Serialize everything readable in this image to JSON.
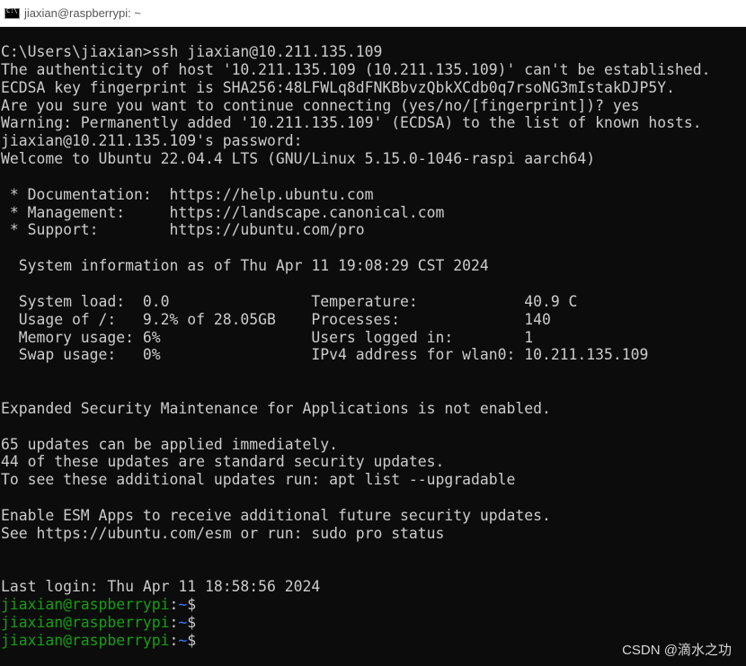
{
  "window": {
    "title": "jiaxian@raspberrypi: ~"
  },
  "terminal": {
    "colors": {
      "background": "#0c0c0c",
      "text": "#cccccc",
      "prompt_user": "#13a10e",
      "prompt_path": "#3b78ff"
    },
    "lines": [
      "C:\\Users\\jiaxian>ssh jiaxian@10.211.135.109",
      "The authenticity of host '10.211.135.109 (10.211.135.109)' can't be established.",
      "ECDSA key fingerprint is SHA256:48LFWLq8dFNKBbvzQbkXCdb0q7rsoNG3mIstakDJP5Y.",
      "Are you sure you want to continue connecting (yes/no/[fingerprint])? yes",
      "Warning: Permanently added '10.211.135.109' (ECDSA) to the list of known hosts.",
      "jiaxian@10.211.135.109's password:",
      "Welcome to Ubuntu 22.04.4 LTS (GNU/Linux 5.15.0-1046-raspi aarch64)",
      "",
      " * Documentation:  https://help.ubuntu.com",
      " * Management:     https://landscape.canonical.com",
      " * Support:        https://ubuntu.com/pro",
      "",
      "  System information as of Thu Apr 11 19:08:29 CST 2024",
      "",
      "  System load:  0.0                Temperature:            40.9 C",
      "  Usage of /:   9.2% of 28.05GB    Processes:              140",
      "  Memory usage: 6%                 Users logged in:        1",
      "  Swap usage:   0%                 IPv4 address for wlan0: 10.211.135.109",
      "",
      "",
      "Expanded Security Maintenance for Applications is not enabled.",
      "",
      "65 updates can be applied immediately.",
      "44 of these updates are standard security updates.",
      "To see these additional updates run: apt list --upgradable",
      "",
      "Enable ESM Apps to receive additional future security updates.",
      "See https://ubuntu.com/esm or run: sudo pro status",
      "",
      "",
      "Last login: Thu Apr 11 18:58:56 2024"
    ],
    "prompts": [
      {
        "user": "jiaxian@raspberrypi",
        "sep": ":",
        "path": "~",
        "symbol": "$"
      },
      {
        "user": "jiaxian@raspberrypi",
        "sep": ":",
        "path": "~",
        "symbol": "$"
      },
      {
        "user": "jiaxian@raspberrypi",
        "sep": ":",
        "path": "~",
        "symbol": "$"
      }
    ]
  },
  "watermark": "CSDN @滴水之功"
}
